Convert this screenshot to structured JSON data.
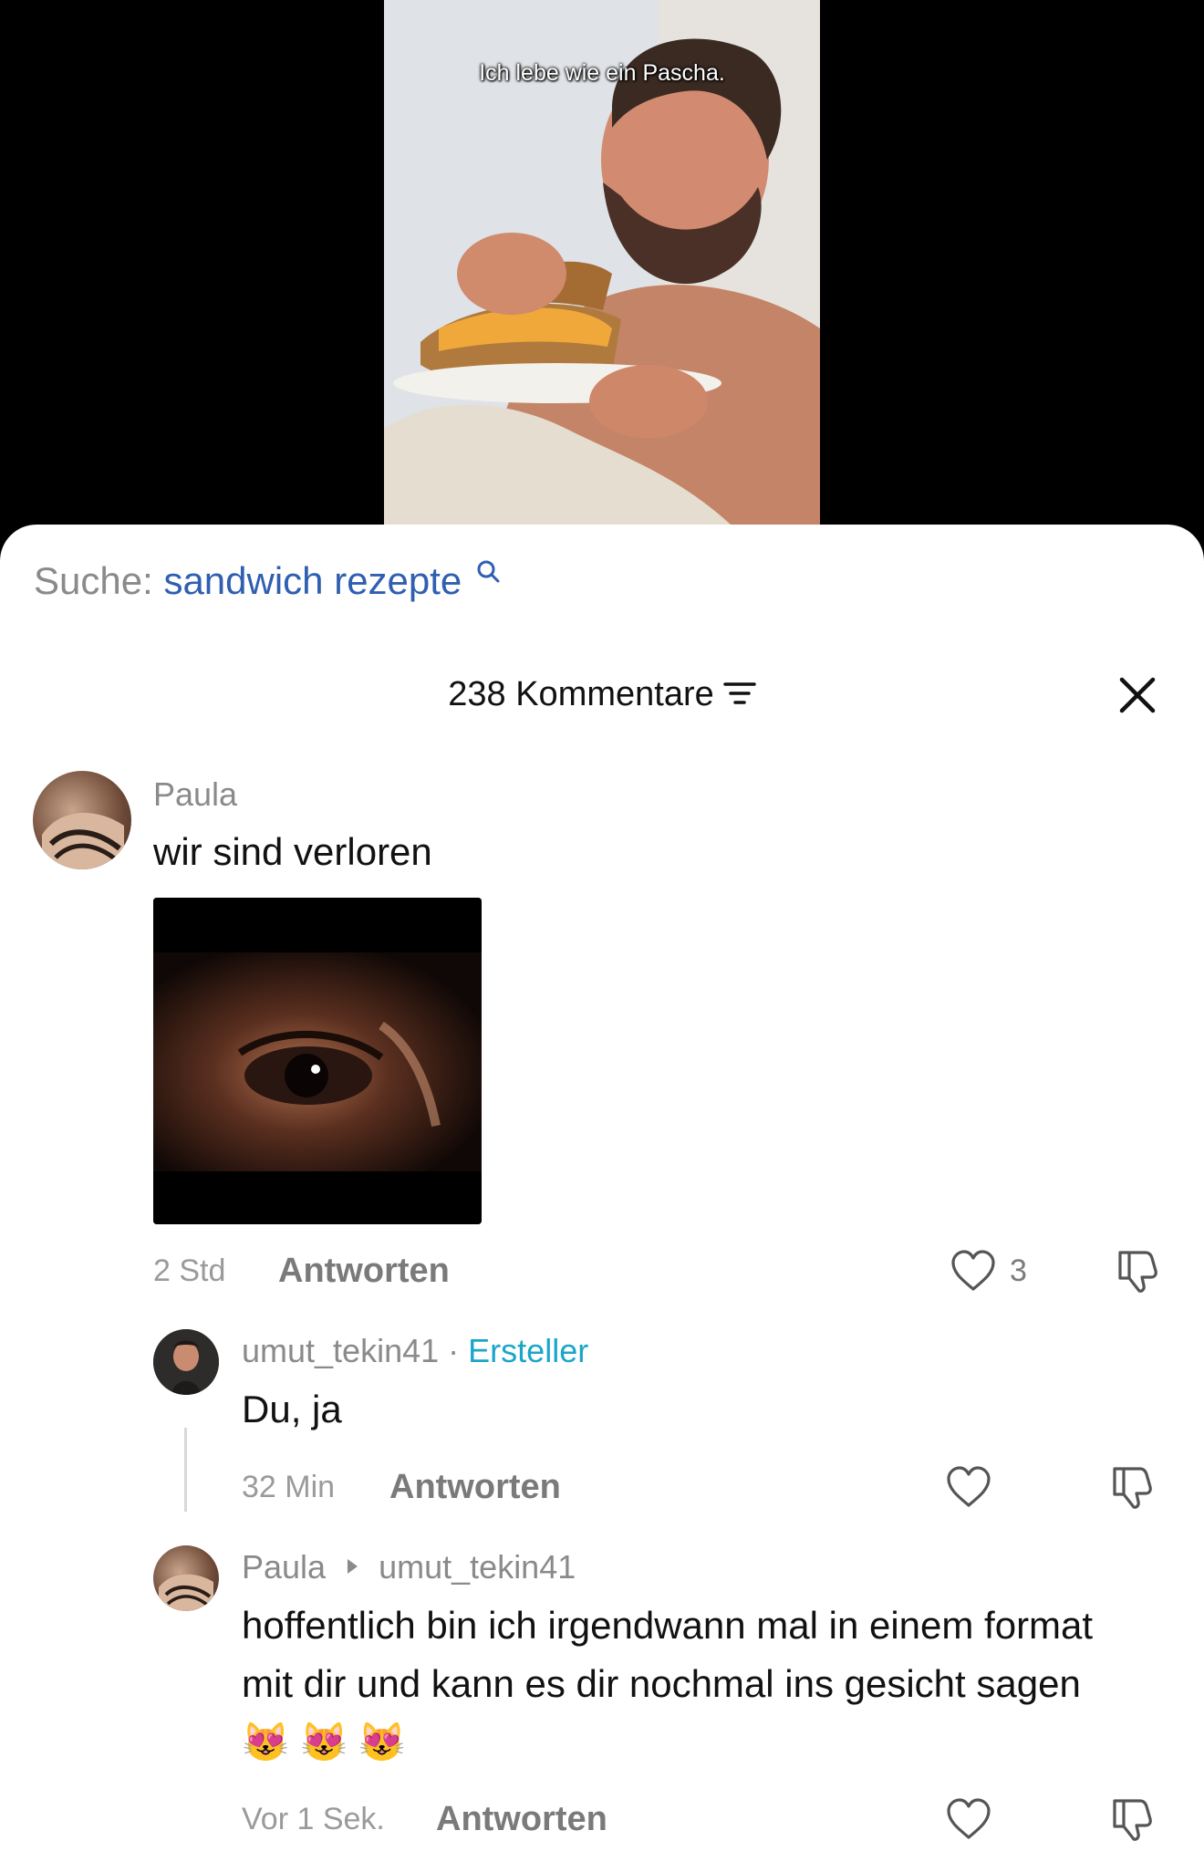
{
  "video": {
    "caption": "Ich lebe wie ein Pascha."
  },
  "search": {
    "label": "Suche:",
    "query": "sandwich rezepte"
  },
  "comments_header": {
    "title": "238 Kommentare"
  },
  "comments": [
    {
      "user": "Paula",
      "text": "wir sind verloren",
      "time": "2 Std",
      "reply_label": "Antworten",
      "likes": "3"
    },
    {
      "user": "umut_tekin41",
      "badge": "Ersteller",
      "separator": "·",
      "text": "Du, ja",
      "time": "32 Min",
      "reply_label": "Antworten"
    },
    {
      "user": "Paula",
      "reply_to": "umut_tekin41",
      "text": "hoffentlich bin ich irgendwann mal in einem format mit dir und kann es dir nochmal ins gesicht sagen",
      "emojis": "😻 😻 😻",
      "time": "Vor 1 Sek.",
      "reply_label": "Antworten"
    }
  ]
}
